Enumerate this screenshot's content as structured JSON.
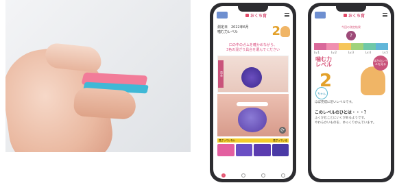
{
  "app": {
    "title": "おくち育"
  },
  "phone1": {
    "info_line1": "測定日　2022年6月",
    "info_line2": "噛む力レベル",
    "level": "2",
    "instruction_line1": "口の中のガムを確かめながら、",
    "instruction_line2": "3色の混ざり具合を選んでください",
    "side_label": "見本",
    "labels_left": "混ざっていない",
    "labels_right": "混ざっている",
    "swatch_colors": [
      "#e35fa0",
      "#6a4fc4",
      "#5b3cb0",
      "#4a3aa6"
    ]
  },
  "phone2": {
    "gauge_title": "今回の測定結果",
    "pin_value": "?",
    "scale_colors": [
      "#d9689a",
      "#f08fb0",
      "#f6c65a",
      "#9fd27a",
      "#6fc8a8",
      "#61b6d9"
    ],
    "scale_ticks": [
      "Lv.1",
      "Lv.2",
      "Lv.3",
      "Lv.4",
      "Lv.5"
    ],
    "chew_text_line1": "噛む力",
    "chew_text_line2": "レベル",
    "level": "2",
    "circle_text": "ちゃん",
    "badge_text": "ほかのレベルを見る",
    "caption": "ほぼ完成に近いレベルです。",
    "heading": "このレベルのひとは・・・？",
    "body_line1": "ふくかむことにいくがあるようです。",
    "body_line2": "やわらかいものを、ゆっくりかんでいます。"
  }
}
